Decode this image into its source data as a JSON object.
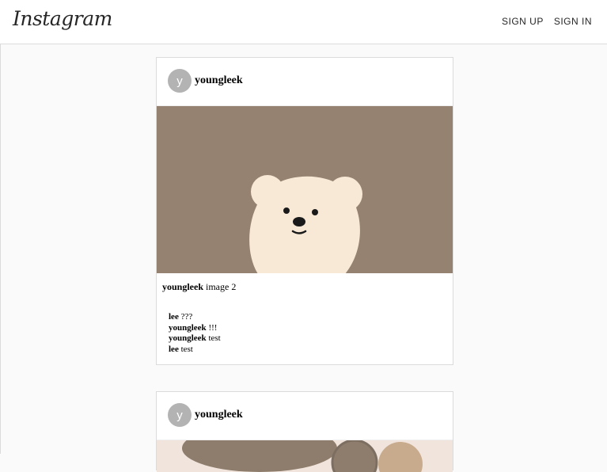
{
  "app": {
    "logo": "Instagram"
  },
  "nav": {
    "sign_up": "SIGN UP",
    "sign_in": "SIGN IN"
  },
  "posts": [
    {
      "avatar_letter": "y",
      "username": "youngleek",
      "caption_user": "youngleek",
      "caption_text": "image 2",
      "comments": [
        {
          "user": "lee",
          "text": "???"
        },
        {
          "user": "youngleek",
          "text": "!!!"
        },
        {
          "user": "youngleek",
          "text": "test"
        },
        {
          "user": "lee",
          "text": "test"
        }
      ]
    },
    {
      "avatar_letter": "y",
      "username": "youngleek"
    }
  ],
  "colors": {
    "image_bg": "#958270",
    "bear": "#f8e9d6"
  }
}
